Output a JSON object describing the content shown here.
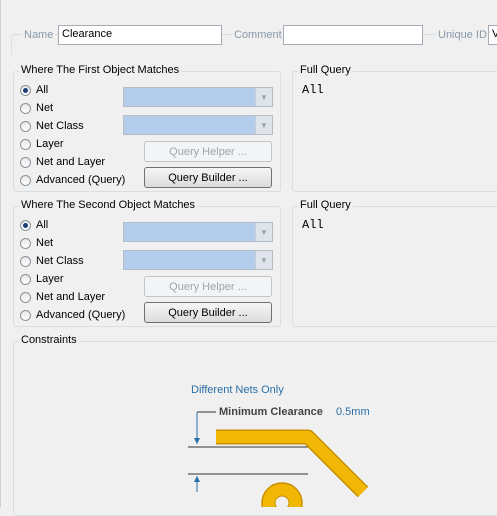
{
  "top": {
    "name_label": "Name",
    "name_value": "Clearance",
    "comment_label": "Comment",
    "comment_value": "",
    "uniqueid_label": "Unique ID",
    "uniqueid_value": "V"
  },
  "first": {
    "title": "Where The First Object Matches",
    "options": [
      "All",
      "Net",
      "Net Class",
      "Layer",
      "Net and Layer",
      "Advanced (Query)"
    ],
    "selected": "All",
    "query_helper_label": "Query Helper ...",
    "query_builder_label": "Query Builder ...",
    "full_query_title": "Full Query",
    "full_query_text": "All"
  },
  "second": {
    "title": "Where The Second Object Matches",
    "options": [
      "All",
      "Net",
      "Net Class",
      "Layer",
      "Net and Layer",
      "Advanced (Query)"
    ],
    "selected": "All",
    "query_helper_label": "Query Helper ...",
    "query_builder_label": "Query Builder ...",
    "full_query_title": "Full Query",
    "full_query_text": "All"
  },
  "constraints": {
    "title": "Constraints",
    "diff_nets_label": "Different Nets Only",
    "min_clearance_label": "Minimum Clearance",
    "min_clearance_value": "0.5mm"
  },
  "colors": {
    "accent_blue": "#2a6ea8",
    "trace_gold": "#f2b705",
    "combo_fill": "#b4cdec"
  }
}
